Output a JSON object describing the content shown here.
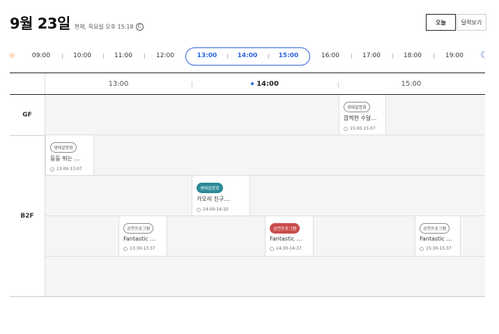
{
  "header": {
    "title": "9월 23일",
    "now_label": "현재, 목요일 오후 15:18",
    "refresh_glyph": "C"
  },
  "buttons": {
    "today": "오늘",
    "calendar": "달력보기"
  },
  "timebar": {
    "hours": [
      "09:00",
      "10:00",
      "11:00",
      "12:00",
      "13:00",
      "14:00",
      "15:00",
      "16:00",
      "17:00",
      "18:00",
      "19:00"
    ],
    "selected": [
      "13:00",
      "14:00",
      "15:00"
    ],
    "start_icon": "sun-icon",
    "end_icon": "moon-icon"
  },
  "grid": {
    "columns": [
      "13:00",
      "14:00",
      "15:00"
    ],
    "current_column": "14:00",
    "floors": [
      "GF",
      "B2F"
    ]
  },
  "events": [
    {
      "floor": "GF",
      "category": "생태설명회",
      "style": "outline",
      "title": "깜찍한 수달…",
      "time": "15:00-15:07"
    },
    {
      "floor": "B2F",
      "category": "생태설명회",
      "style": "outline",
      "title": "둥둥 뛰는 …",
      "time": "13:00-13:07"
    },
    {
      "floor": "B2F",
      "category": "생태설명회",
      "style": "teal",
      "title": "가오리 친구…",
      "time": "14:00-14:10"
    },
    {
      "floor": "B2F",
      "category": "공연프로그램",
      "style": "outline",
      "title": "Fantastic …",
      "time": "13:30-13:37"
    },
    {
      "floor": "B2F",
      "category": "공연프로그램",
      "style": "red",
      "title": "Fantastic …",
      "time": "14:30-14:37"
    },
    {
      "floor": "B2F",
      "category": "공연프로그램",
      "style": "outline",
      "title": "Fantastic …",
      "time": "15:30-15:37"
    }
  ],
  "colors": {
    "accent": "#2a64e0",
    "teal": "#2a8a95",
    "red": "#c94c4c"
  }
}
